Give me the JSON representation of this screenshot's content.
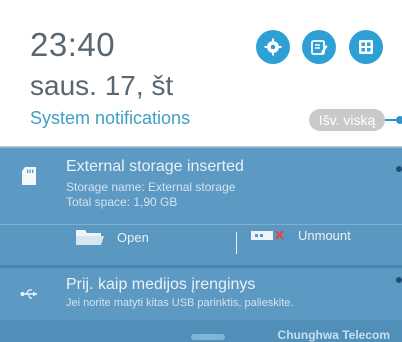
{
  "header": {
    "time": "23:40",
    "date": "saus. 17, št",
    "section_title": "System notifications",
    "clear_all_label": "Išv. viską",
    "quick_buttons": [
      "settings-icon",
      "edit-icon",
      "grid-icon"
    ]
  },
  "notifications": [
    {
      "icon": "sd-card-icon",
      "title": "External storage inserted",
      "lines": [
        "Storage name: External storage",
        "Total space: 1,90 GB"
      ],
      "actions": [
        {
          "icon": "folder-icon",
          "label": "Open"
        },
        {
          "icon": "unmount-icon",
          "label": "Unmount"
        }
      ]
    },
    {
      "icon": "usb-icon",
      "title": "Prij. kaip medijos įrenginys",
      "lines": [
        "Jei norite matyti kitas USB parinktis, palieskite."
      ]
    }
  ],
  "status": {
    "carrier": "Chunghwa Telecom"
  },
  "colors": {
    "accent": "#2ea0d6",
    "panel": "#5c99c3",
    "header_bg": "#ffffff"
  }
}
